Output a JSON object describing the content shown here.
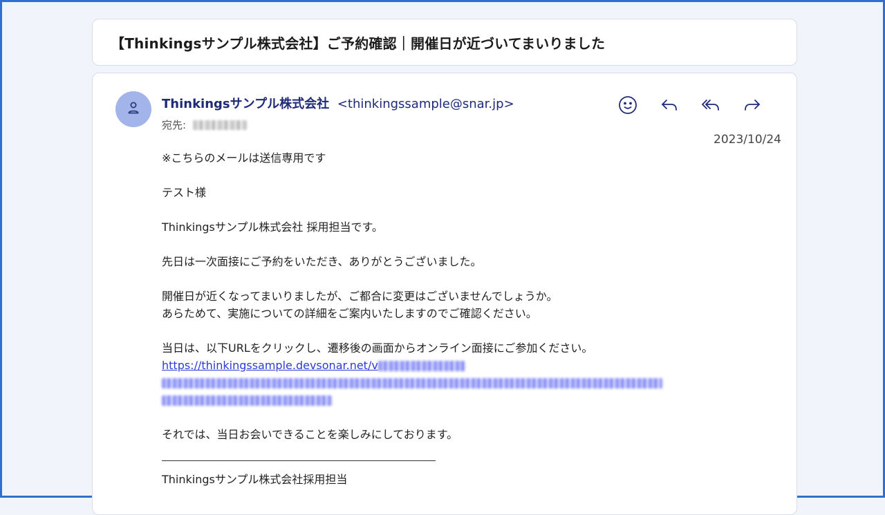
{
  "subject": "【Thinkingsサンプル株式会社】ご予約確認｜開催日が近づいてまいりました",
  "sender": {
    "name": "Thinkingsサンプル株式会社",
    "email": "<thinkingssample@snar.jp>"
  },
  "recipient_label": "宛先:",
  "date": "2023/10/24",
  "icons": {
    "avatar": "person-icon",
    "react": "smiley-icon",
    "reply": "reply-icon",
    "reply_all": "reply-all-icon",
    "forward": "forward-icon"
  },
  "body": {
    "notice": "※こちらのメールは送信専用です",
    "greeting": "テスト様",
    "intro": "Thinkingsサンプル株式会社 採用担当です。",
    "thanks": "先日は一次面接にご予約をいただき、ありがとうございました。",
    "confirm_line1": "開催日が近くなってまいりましたが、ご都合に変更はございませんでしょうか。",
    "confirm_line2": "あらためて、実施についての詳細をご案内いたしますのでご確認ください。",
    "instruction": "当日は、以下URLをクリックし、遷移後の画面からオンライン面接にご参加ください。",
    "url_visible": "https://thinkingssample.devsonar.net/v",
    "closing": "それでは、当日お会いできることを楽しみにしております。",
    "signature": "Thinkingsサンプル株式会社採用担当"
  },
  "colors": {
    "frame": "#2f6fd0",
    "avatar": "#a3b4ea",
    "sender": "#1e2a78",
    "link": "#2a3bd6"
  }
}
